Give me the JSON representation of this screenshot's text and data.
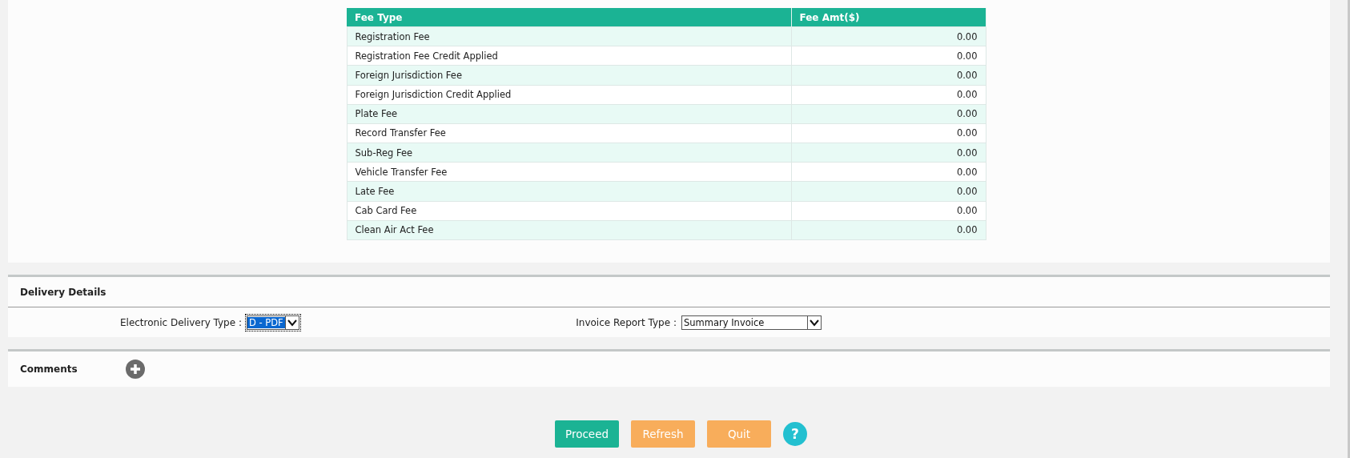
{
  "fee_table": {
    "columns": [
      "Fee Type",
      "Fee Amt($)"
    ],
    "rows": [
      [
        "Registration Fee",
        "0.00"
      ],
      [
        "Registration Fee Credit Applied",
        "0.00"
      ],
      [
        "Foreign Jurisdiction Fee",
        "0.00"
      ],
      [
        "Foreign Jurisdiction Credit Applied",
        "0.00"
      ],
      [
        "Plate Fee",
        "0.00"
      ],
      [
        "Record Transfer Fee",
        "0.00"
      ],
      [
        "Sub-Reg Fee",
        "0.00"
      ],
      [
        "Vehicle Transfer Fee",
        "0.00"
      ],
      [
        "Late Fee",
        "0.00"
      ],
      [
        "Cab Card Fee",
        "0.00"
      ],
      [
        "Clean Air Act Fee",
        "0.00"
      ]
    ]
  },
  "delivery_details": {
    "title": "Delivery Details",
    "fields": [
      {
        "label": "Electronic Delivery Type",
        "separator": ":",
        "value": "D - PDF",
        "focused": true
      },
      {
        "label": "Invoice Report Type",
        "separator": ":",
        "value": "Summary Invoice",
        "focused": false
      }
    ]
  },
  "comments": {
    "title": "Comments"
  },
  "buttons": [
    {
      "label": "Proceed",
      "kind": "primary"
    },
    {
      "label": "Refresh",
      "kind": "secondary"
    },
    {
      "label": "Quit",
      "kind": "secondary"
    },
    {
      "label": "?",
      "kind": "help"
    }
  ]
}
